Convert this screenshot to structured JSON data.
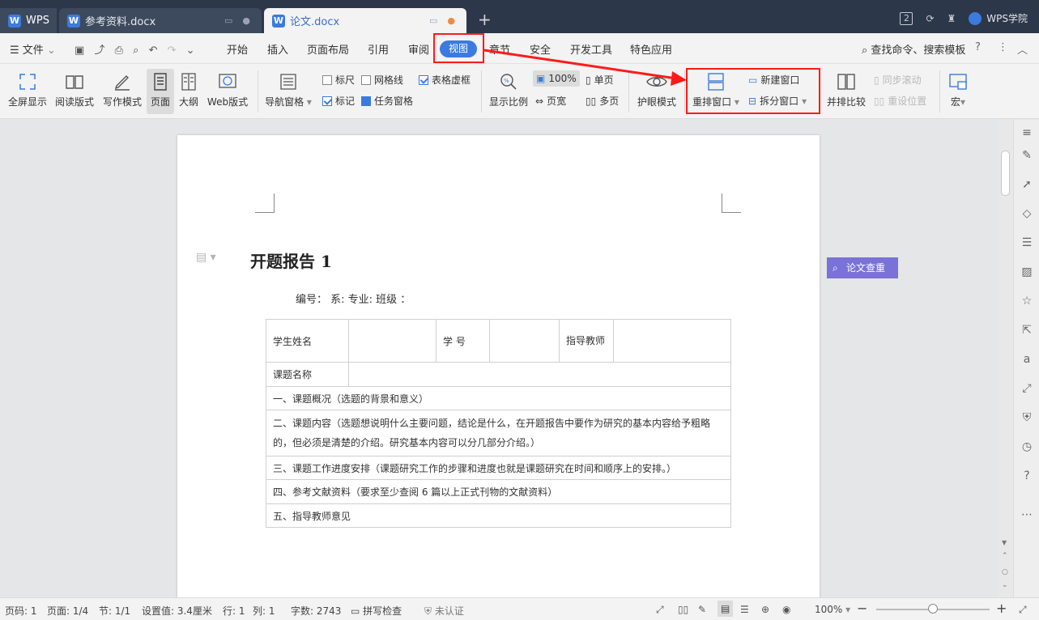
{
  "tabs": [
    {
      "label": "WPS"
    },
    {
      "label": "参考资料.docx"
    },
    {
      "label": "论文.docx"
    }
  ],
  "titlebar_right": {
    "window_count": "2",
    "academy": "WPS学院"
  },
  "menu": {
    "file": "文件",
    "items": [
      "开始",
      "插入",
      "页面布局",
      "引用",
      "审阅",
      "视图",
      "章节",
      "安全",
      "开发工具",
      "特色应用"
    ],
    "search": "查找命令、搜索模板",
    "help": "?"
  },
  "ribbon": {
    "fullscreen": "全屏显示",
    "reading": "阅读版式",
    "writing": "写作模式",
    "page": "页面",
    "outline": "大纲",
    "web": "Web版式",
    "nav_pane": "导航窗格",
    "ruler": "标尺",
    "gridlines": "网格线",
    "table_gridlines": "表格虚框",
    "marks": "标记",
    "task_pane": "任务窗格",
    "zoom_ratio": "显示比例",
    "zoom_100": "100%",
    "single_page": "单页",
    "page_width": "页宽",
    "multi_page": "多页",
    "eye_mode": "护眼模式",
    "rearrange_window": "重排窗口",
    "new_window": "新建窗口",
    "split_window": "拆分窗口",
    "side_by_side": "并排比较",
    "sync_scroll": "同步滚动",
    "reset_position": "重设位置",
    "macro": "宏"
  },
  "document": {
    "title": "开题报告 1",
    "subtitle": "编号：    系:  专业:  班级 ：",
    "table": {
      "r1": [
        "学生姓名",
        "",
        "学  号",
        "",
        "指导教师",
        ""
      ],
      "r2": [
        "课题名称",
        ""
      ],
      "r3": "一、课题概况（选题的背景和意义）",
      "r4": "二、课题内容（选题想说明什么主要问题，结论是什么，在开题报告中要作为研究的基本内容给予粗略的，但必须是清楚的介绍。研究基本内容可以分几部分介绍。）",
      "r5": "三、课题工作进度安排（课题研究工作的步骤和进度也就是课题研究在时间和顺序上的安排。）",
      "r6": "四、参考文献资料（要求至少查阅 6 篇以上正式刊物的文献资料）",
      "r7": "五、指导教师意见"
    }
  },
  "thesis_check": "论文查重",
  "status": {
    "page_code": "页码: 1",
    "page": "页面: 1/4",
    "section": "节: 1/1",
    "setting": "设置值: 3.4厘米",
    "row": "行: 1",
    "col": "列: 1",
    "words": "字数: 2743",
    "spell": "拼写检查",
    "cert": "未认证",
    "zoom": "100%"
  },
  "colors": {
    "accent": "#3b7bdf",
    "highlight_red": "#ff1a1a",
    "thesis_btn": "#7a72d8"
  }
}
